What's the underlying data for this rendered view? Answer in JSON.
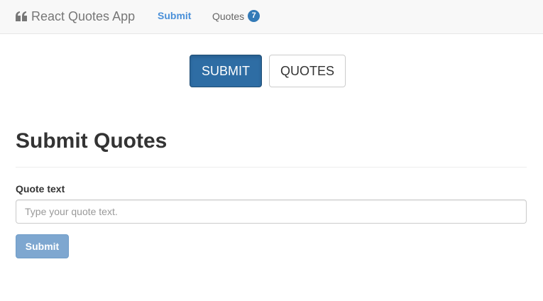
{
  "navbar": {
    "brand_icon": "quote-left-icon",
    "brand": "React Quotes App",
    "links": {
      "submit": "Submit",
      "quotes": "Quotes",
      "quotes_count": "7"
    }
  },
  "toggle": {
    "submit_label": "SUBMIT",
    "quotes_label": "QUOTES",
    "active": "submit"
  },
  "page": {
    "title": "Submit Quotes"
  },
  "form": {
    "label": "Quote text",
    "placeholder": "Type your quote text.",
    "value": "",
    "submit_label": "Submit",
    "submit_disabled": true
  },
  "colors": {
    "active_button": "#2e6da4",
    "nav_active": "#4a90d9",
    "badge": "#337ab7",
    "disabled_submit": "#7ea7d0"
  }
}
